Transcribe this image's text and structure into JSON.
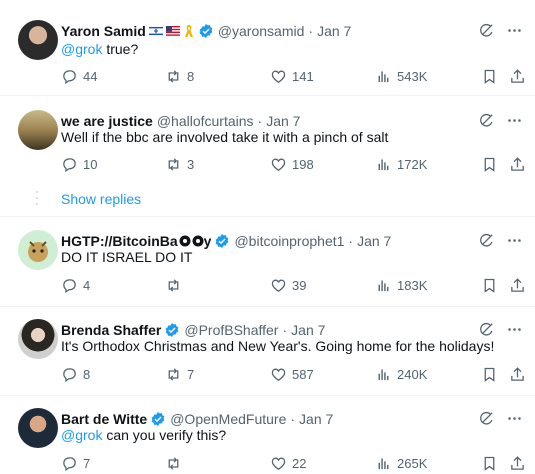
{
  "tweets": [
    {
      "name": "Yaron Samid",
      "handle": "@yaronsamid",
      "date": "Jan 7",
      "mention": "@grok",
      "text": " true?",
      "replies": "44",
      "reposts": "8",
      "likes": "141",
      "views": "543K"
    },
    {
      "name": "we are justice",
      "handle": "@hallofcurtains",
      "date": "Jan 7",
      "mention": "",
      "text": "Well if the bbc are involved take it with a pinch of salt",
      "replies": "10",
      "reposts": "3",
      "likes": "198",
      "views": "172K"
    },
    {
      "name": "HGTP://BitcoinBa",
      "name_suffix": "y",
      "handle": "@bitcoinprophet1",
      "date": "Jan 7",
      "mention": "",
      "text": "DO IT ISRAEL DO IT",
      "replies": "4",
      "reposts": "",
      "likes": "39",
      "views": "183K"
    },
    {
      "name": "Brenda Shaffer",
      "handle": "@ProfBShaffer",
      "date": "Jan 7",
      "mention": "",
      "text": "It's Orthodox Christmas and New Year's. Going home for the holidays!",
      "replies": "8",
      "reposts": "7",
      "likes": "587",
      "views": "240K"
    },
    {
      "name": "Bart de Witte",
      "handle": "@OpenMedFuture",
      "date": "Jan 7",
      "mention": "@grok",
      "text": " can you verify this?",
      "replies": "7",
      "reposts": "",
      "likes": "22",
      "views": "265K"
    }
  ],
  "show_replies_label": "Show replies",
  "colors": {
    "accent": "#1d9bf0",
    "muted": "#536471",
    "text": "#0f1419",
    "divider": "#eff3f4",
    "gold": "#f4b400"
  }
}
